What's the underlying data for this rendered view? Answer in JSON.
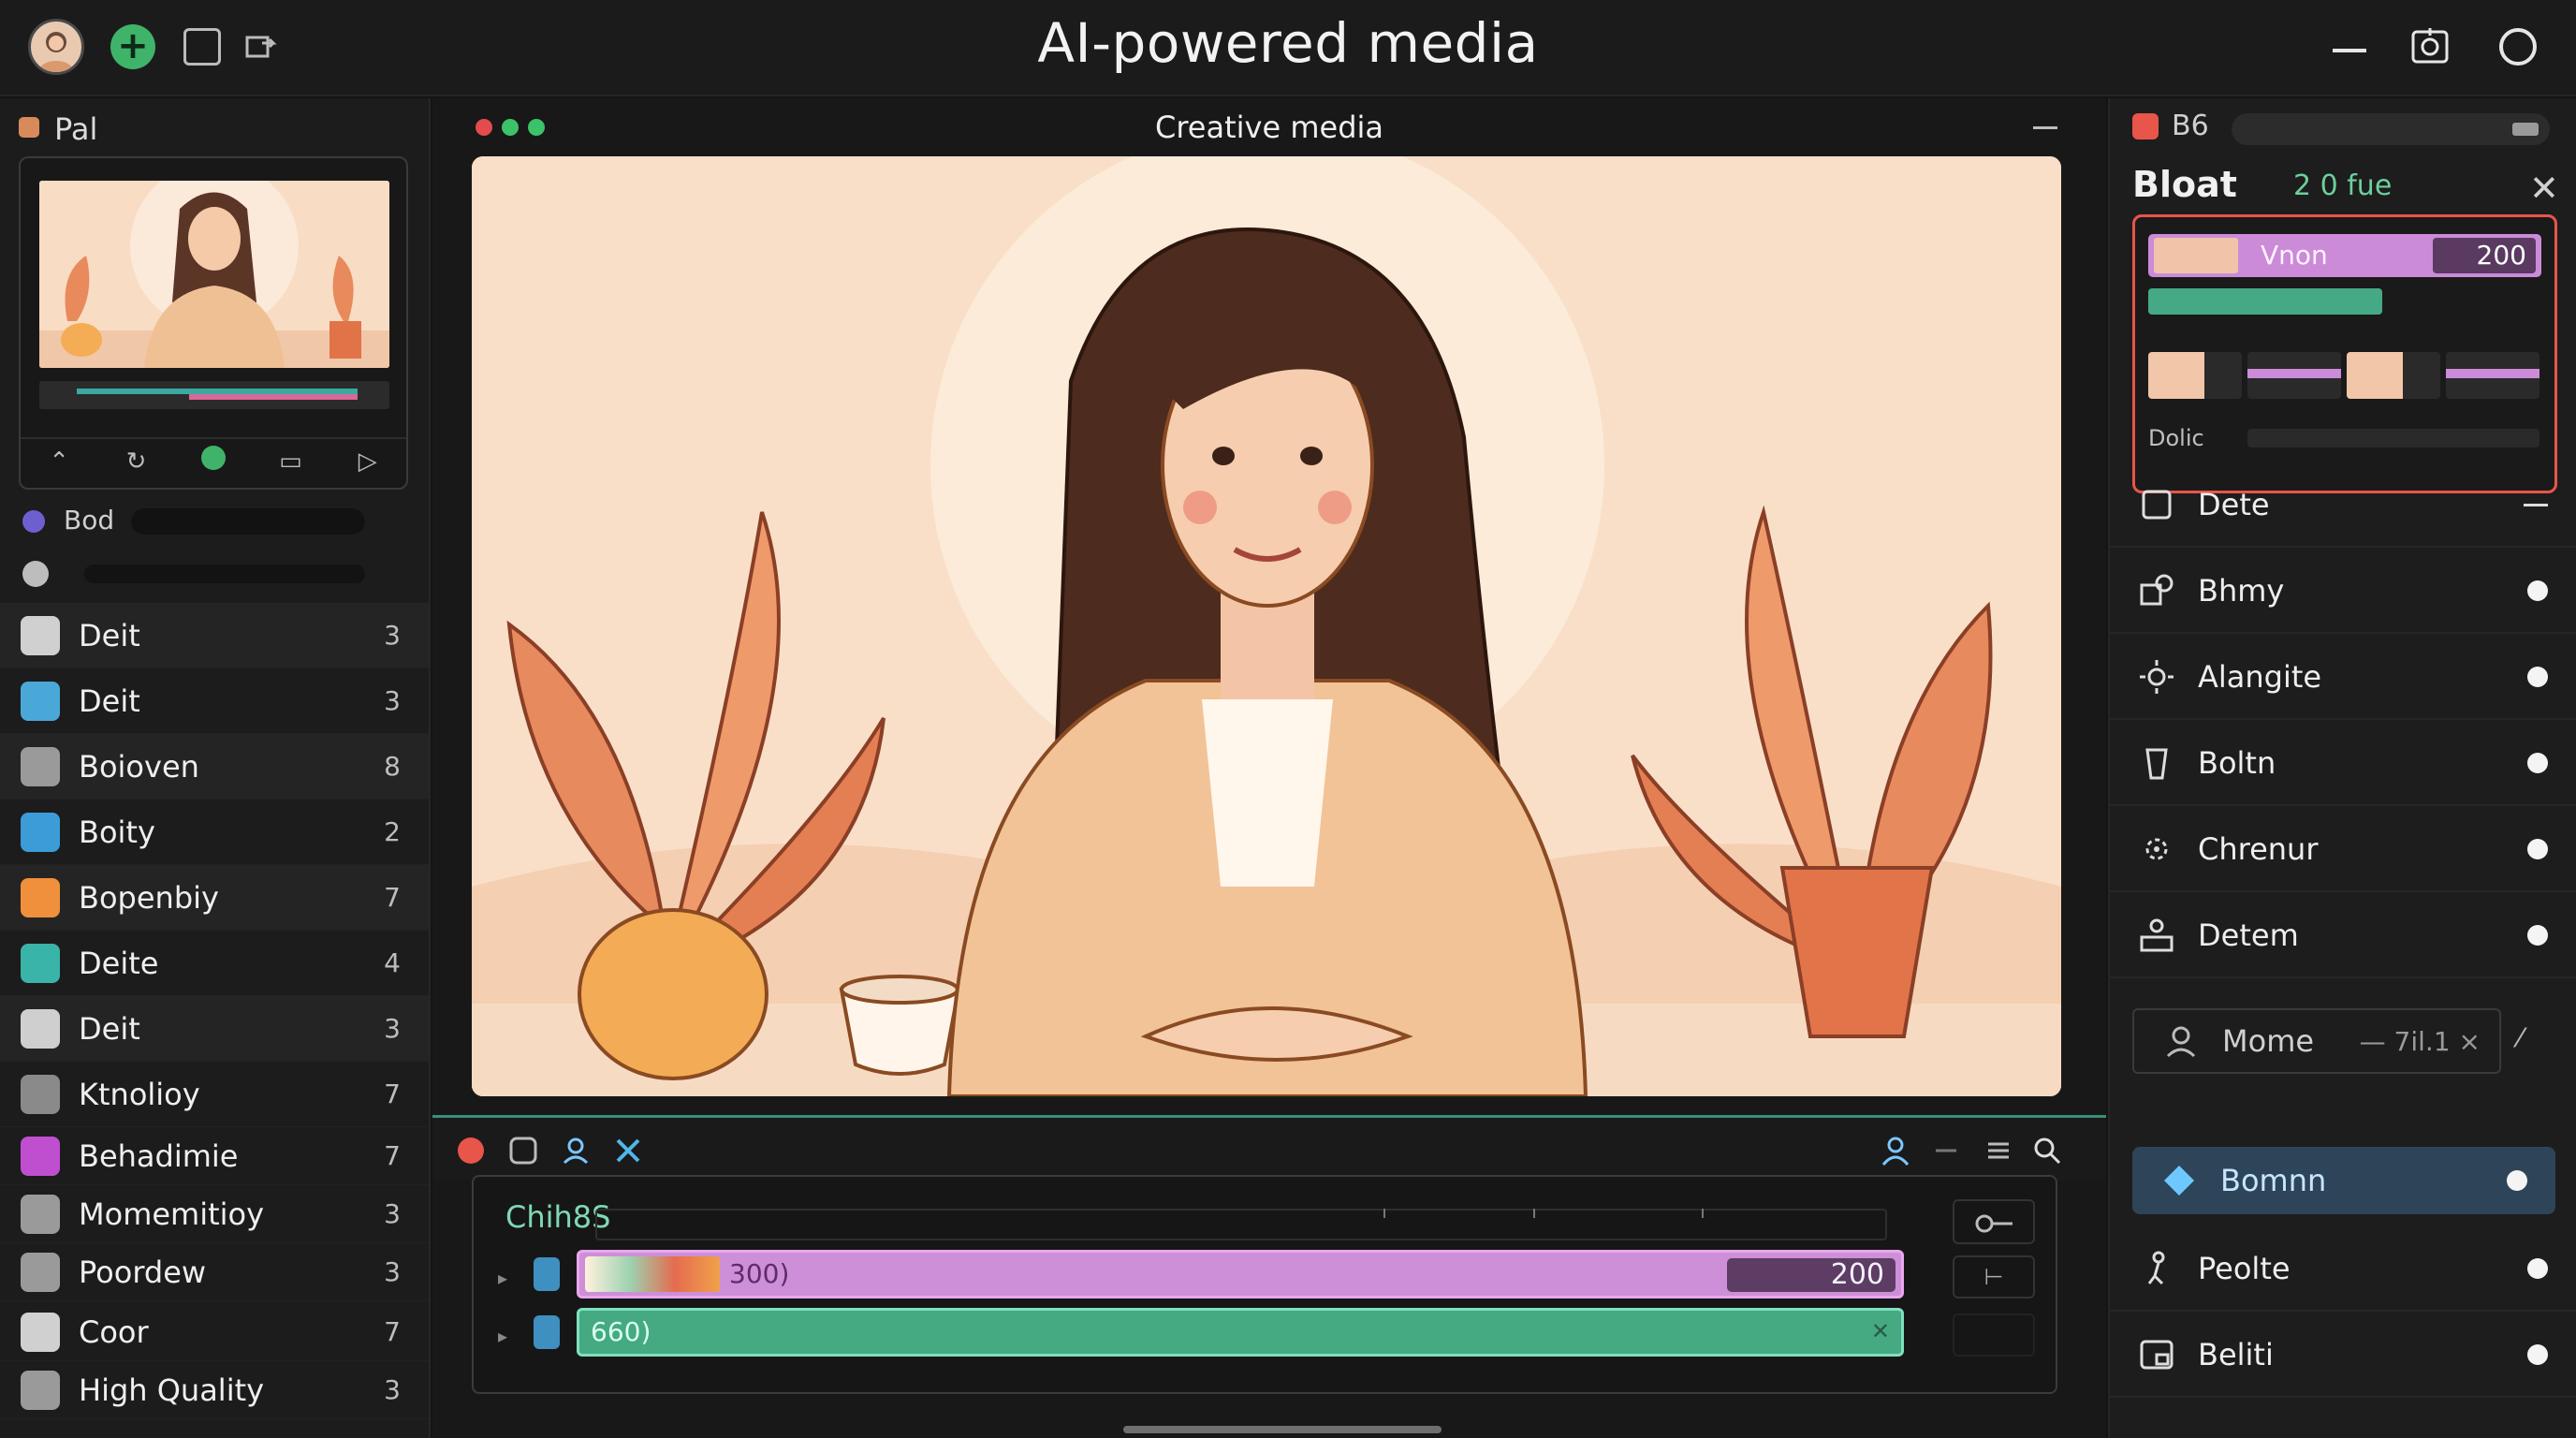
{
  "app": {
    "title": "AI-powered media"
  },
  "left_panel": {
    "title": "Pal",
    "search_label": "Bod",
    "user_row_label": "",
    "items": [
      {
        "label": "Deit",
        "count": "3"
      },
      {
        "label": "Deit",
        "count": "3"
      },
      {
        "label": "Boioven",
        "count": "8"
      },
      {
        "label": "Boity",
        "count": "2"
      },
      {
        "label": "Bopenbiy",
        "count": "7"
      },
      {
        "label": "Deite",
        "count": "4"
      },
      {
        "label": "Deit",
        "count": "3"
      },
      {
        "label": "Ktnolioy",
        "count": "7"
      },
      {
        "label": "Behadimie",
        "count": "7"
      },
      {
        "label": "Momemitioy",
        "count": "3"
      },
      {
        "label": "Poordew",
        "count": "3"
      },
      {
        "label": "Coor",
        "count": "7"
      },
      {
        "label": "High Quality",
        "count": "3"
      }
    ]
  },
  "center": {
    "title": "Creative media",
    "timeline": {
      "label": "Chih8S",
      "track1_text": "300)",
      "track1_value": "200",
      "track2_text": "660)"
    }
  },
  "right_panel": {
    "header": "B6",
    "title": "Bloat",
    "subtitle": "2 0 fue",
    "card": {
      "track_label": "Vnon",
      "track_value": "200",
      "bottom_label": "Dolic"
    },
    "menu": [
      {
        "label": "Dete",
        "icon": "crop-icon",
        "active": false
      },
      {
        "label": "Bhmy",
        "icon": "shapes-icon",
        "active": false
      },
      {
        "label": "Alangite",
        "icon": "brightness-icon",
        "active": false
      },
      {
        "label": "Boltn",
        "icon": "cup-icon",
        "active": false
      },
      {
        "label": "Chrenur",
        "icon": "focus-icon",
        "active": false
      },
      {
        "label": "Detem",
        "icon": "people-icon",
        "active": false
      }
    ],
    "field": {
      "label": "Mome",
      "value": "— 7il.1 ×"
    },
    "menu2": [
      {
        "label": "Bomnn",
        "icon": "diamond-icon",
        "active": true
      },
      {
        "label": "Peolte",
        "icon": "figure-icon",
        "active": false
      },
      {
        "label": "Beliti",
        "icon": "media-icon",
        "active": false
      }
    ]
  },
  "colors": {
    "accent_green": "#3fb36a",
    "accent_red": "#e8554b",
    "track_purple": "#cd8fd7",
    "track_green": "#45a982",
    "active_blue": "#2e4458"
  }
}
